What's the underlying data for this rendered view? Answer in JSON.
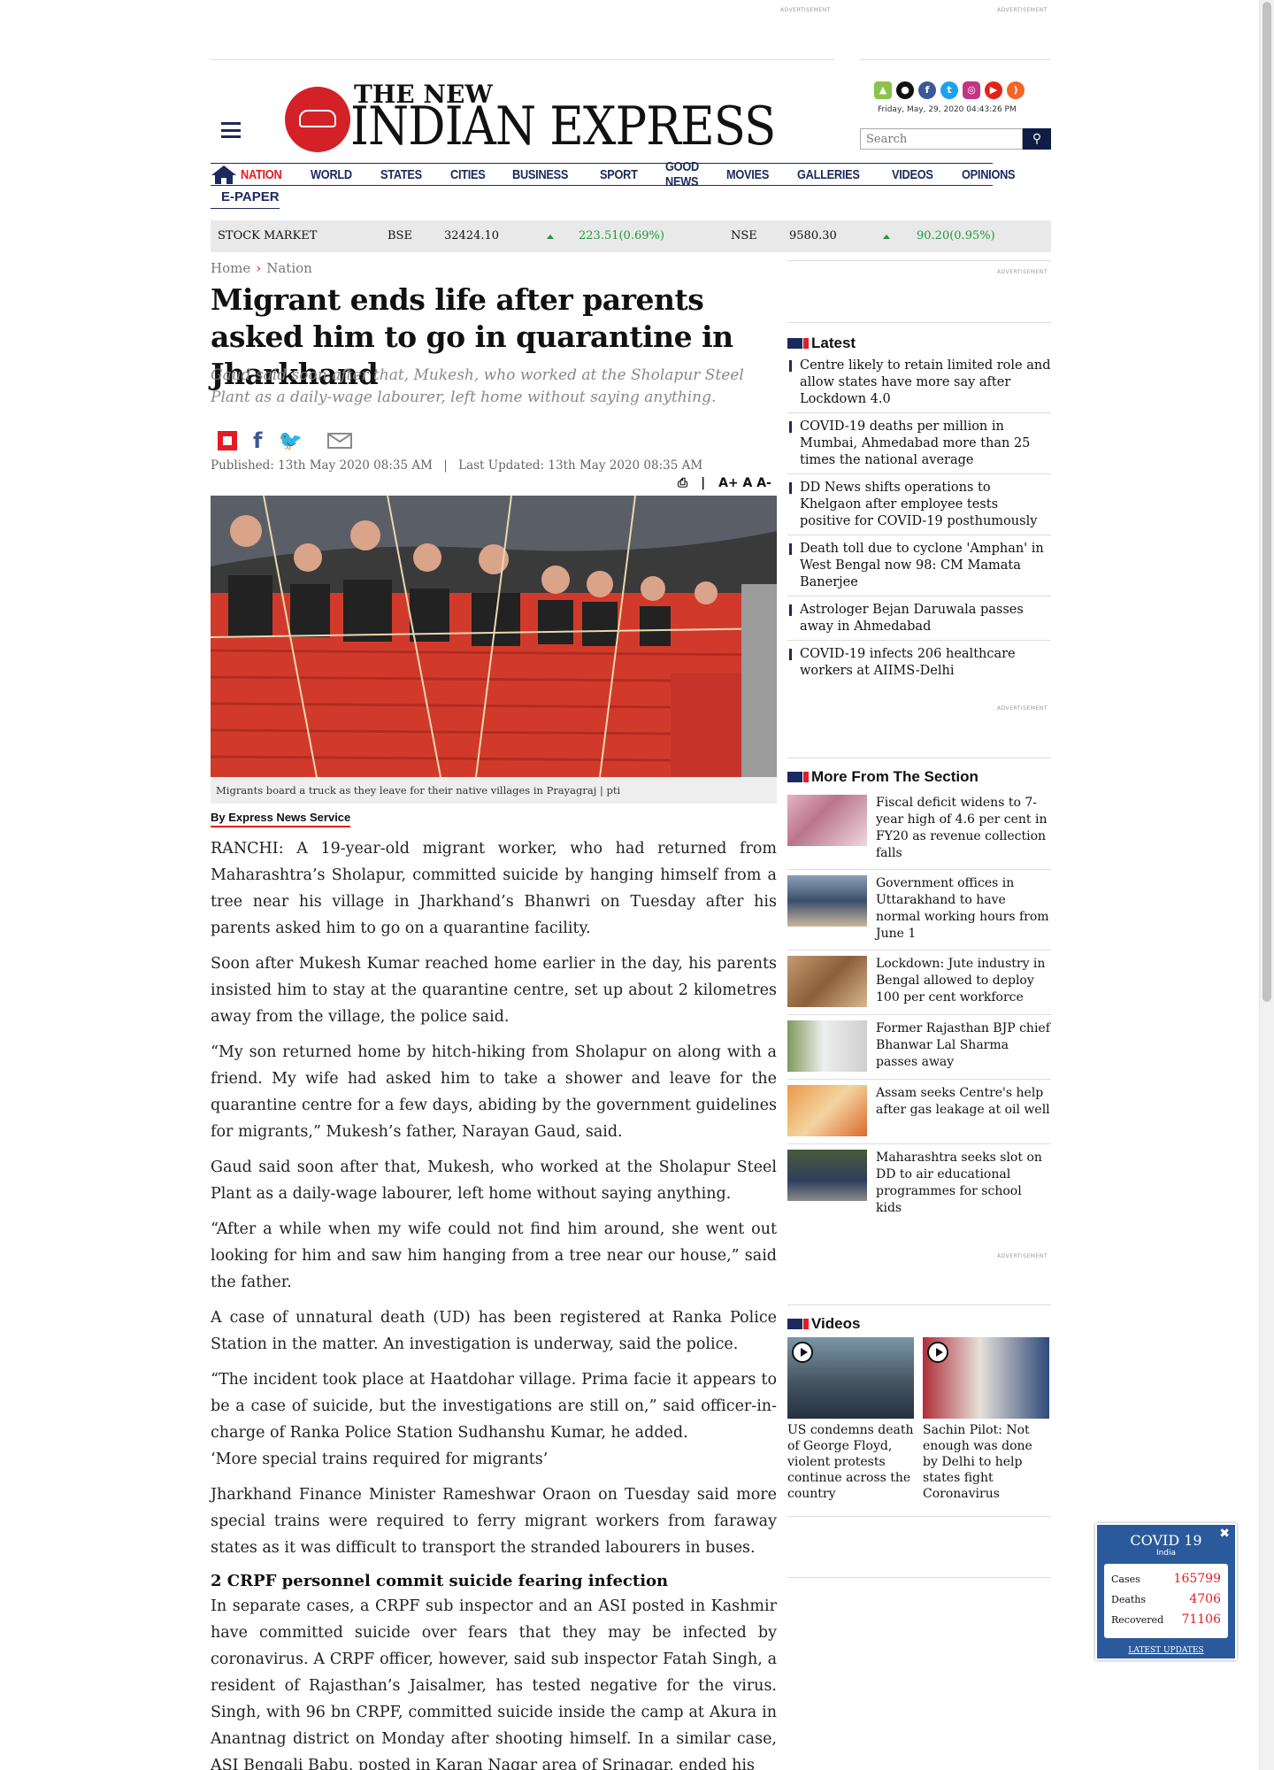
{
  "ads": {
    "label": "ADVERTISEMENT"
  },
  "header": {
    "logo_line1": "THE NEW",
    "logo_line2": "INDIAN EXPRESS",
    "date": "Friday, May, 29, 2020  04:43:26 PM",
    "search_placeholder": "Search"
  },
  "nav": {
    "items": [
      "NATION",
      "WORLD",
      "STATES",
      "CITIES",
      "BUSINESS",
      "SPORT",
      "GOOD NEWS",
      "MOVIES",
      "GALLERIES",
      "VIDEOS",
      "OPINIONS"
    ],
    "epaper": "E-PAPER"
  },
  "stock": {
    "label": "STOCK MARKET",
    "bse_label": "BSE",
    "bse_value": "32424.10",
    "bse_change": "223.51(0.69%)",
    "nse_label": "NSE",
    "nse_value": "9580.30",
    "nse_change": "90.20(0.95%)"
  },
  "breadcrumb": {
    "home": "Home",
    "section": "Nation"
  },
  "article": {
    "headline": "Migrant ends life after parents asked him to go in quarantine in Jharkhand",
    "subhead": "Gaud said soon after that, Mukesh, who worked at the Sholapur Steel Plant as a daily-wage labourer, left home without saying anything.",
    "published": "Published: 13th May 2020 08:35 AM",
    "updated": "Last Updated: 13th May 2020 08:35 AM",
    "font_tools": "A+ A A-",
    "caption": "Migrants board a truck as they leave for their native villages in Prayagraj | pti",
    "byline": "By Express News Service",
    "paragraphs": [
      "RANCHI: A 19-year-old migrant worker, who had returned from Maharashtra’s Sholapur, committed suicide by hanging himself from a tree near his village in Jharkhand’s Bhanwri on Tuesday after his parents asked him to go on a quarantine facility.",
      "Soon after Mukesh Kumar reached home earlier in the day, his parents insisted him to stay at the quarantine centre, set up about 2 kilometres away from the village, the police said.",
      "“My son returned home by hitch-hiking from Sholapur on along with a friend. My wife had asked him to take a shower and leave for the quarantine centre for a few days, abiding by the government guidelines for migrants,” Mukesh’s father, Narayan Gaud, said.",
      "Gaud said soon after that, Mukesh, who worked at the Sholapur Steel Plant as a daily-wage labourer, left home without saying anything.",
      "“After a while when my wife could not find him around, she went out looking for him and saw him hanging from a tree near our house,” said the father.",
      "A case of unnatural death (UD) has been registered at Ranka Police Station in the matter. An investigation is underway, said the police.",
      "“The incident took place at Haatdohar village. Prima facie it appears to be a case of suicide, but the investigations are still on,” said officer-in-charge of Ranka Police Station Sudhanshu Kumar, he added.",
      "‘More special trains required for migrants’",
      "Jharkhand Finance Minister Rameshwar Oraon on Tuesday said more special trains were required to ferry migrant workers from faraway states as it was difficult to transport the stranded labourers in buses."
    ],
    "subheading2": "2 CRPF personnel commit suicide fearing infection",
    "last_paragraph": "In separate cases, a CRPF sub inspector and an ASI posted in Kashmir have committed suicide over fears that they may be infected by coronavirus. A CRPF officer, however, said sub inspector Fatah Singh, a resident of Rajasthan’s Jaisalmer, has tested negative for the virus. Singh, with 96 bn CRPF, committed suicide inside the camp at Akura in Anantnag district on Monday after shooting himself. In a similar case, ASI Bengali Babu, posted in Karan Nagar area of Srinagar, ended his"
  },
  "sidebar": {
    "latest_title": "Latest",
    "latest": [
      "Centre likely to retain limited role and allow states have more say after Lockdown 4.0",
      "COVID-19 deaths per million in Mumbai, Ahmedabad more than 25 times the national average",
      "DD News shifts operations to Khelgaon after employee tests positive for COVID-19 posthumously",
      "Death toll due to cyclone 'Amphan' in West Bengal now 98: CM Mamata Banerjee",
      "Astrologer Bejan Daruwala passes away in Ahmedabad",
      "COVID-19 infects 206 healthcare workers at AIIMS-Delhi"
    ],
    "more_title": "More From The Section",
    "more": [
      "Fiscal deficit widens to 7-year high of 4.6 per cent in FY20 as revenue collection falls",
      "Government offices in Uttarakhand to have normal working hours from June 1",
      "Lockdown: Jute industry in Bengal allowed to deploy 100 per cent workforce",
      "Former Rajasthan BJP chief Bhanwar Lal Sharma passes away",
      "Assam seeks Centre's help after gas leakage at oil well",
      "Maharashtra seeks slot on DD to air educational programmes for school kids"
    ],
    "videos_title": "Videos",
    "videos": [
      "US condemns death of George Floyd, violent protests continue across the country",
      "Sachin Pilot: Not enough was done by Delhi to help states fight Coronavirus"
    ]
  },
  "covid": {
    "title": "COVID 19",
    "region": "India",
    "cases_label": "Cases",
    "cases": "165799",
    "deaths_label": "Deaths",
    "deaths": "4706",
    "recovered_label": "Recovered",
    "recovered": "71106",
    "link": "LATEST UPDATES"
  },
  "colors": {
    "brand_red": "#e51b23",
    "navy": "#1b2a5e",
    "up_green": "#1d9a3b"
  }
}
